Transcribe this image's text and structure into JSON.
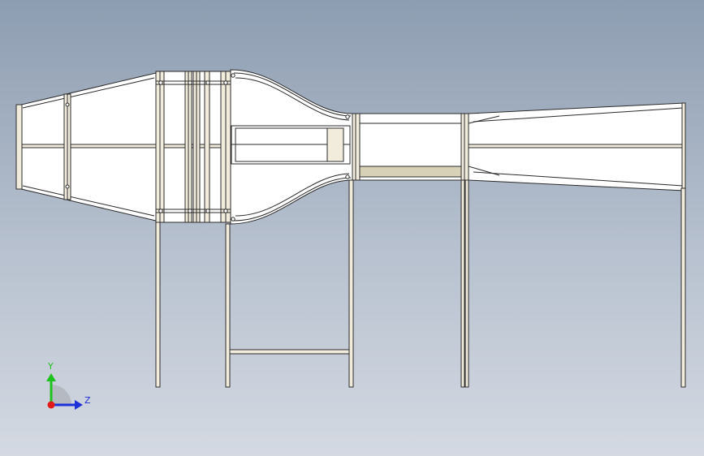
{
  "cad_view": {
    "model": "wind-tunnel-assembly",
    "colors": {
      "background_top": "#8d9db1",
      "background_bottom": "#d4d9e2",
      "panel_fill": "#ffffff",
      "frame_fill": "#f1ecdc",
      "edge": "#2b2b2b",
      "shadow_band": "#d6d1b7"
    }
  },
  "triad": {
    "y_label": "Y",
    "z_label": "Z",
    "x_color": "#e11919",
    "y_color": "#1ec21e",
    "z_color": "#1d2fd8"
  }
}
